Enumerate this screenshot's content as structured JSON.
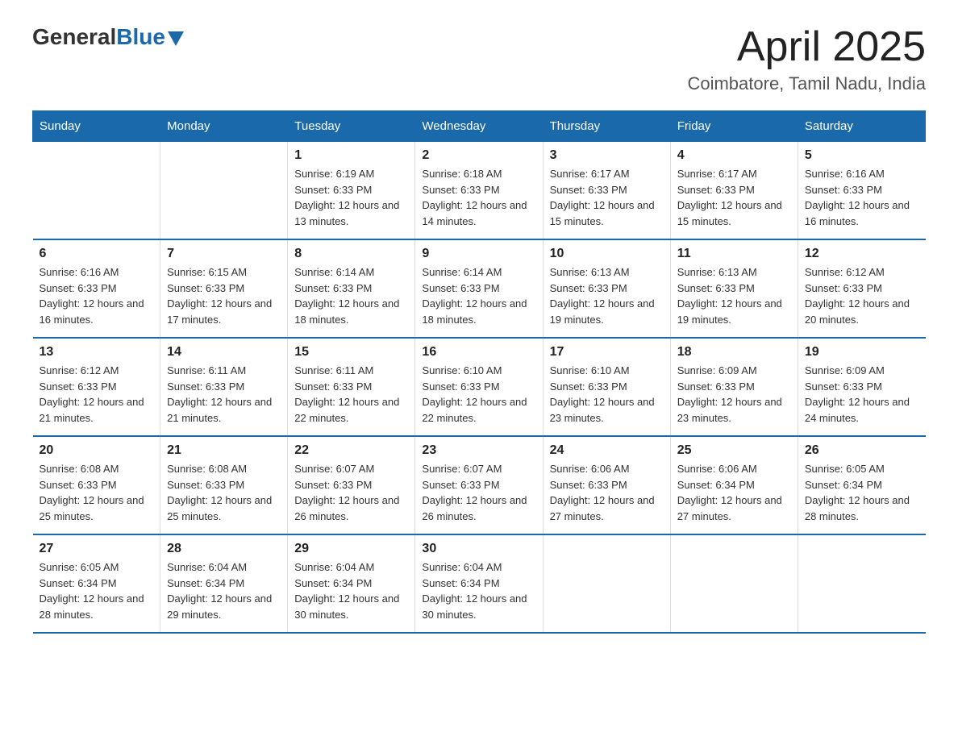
{
  "logo": {
    "general": "General",
    "blue": "Blue"
  },
  "header": {
    "title": "April 2025",
    "location": "Coimbatore, Tamil Nadu, India"
  },
  "weekdays": [
    "Sunday",
    "Monday",
    "Tuesday",
    "Wednesday",
    "Thursday",
    "Friday",
    "Saturday"
  ],
  "weeks": [
    [
      {
        "day": "",
        "sunrise": "",
        "sunset": "",
        "daylight": ""
      },
      {
        "day": "",
        "sunrise": "",
        "sunset": "",
        "daylight": ""
      },
      {
        "day": "1",
        "sunrise": "Sunrise: 6:19 AM",
        "sunset": "Sunset: 6:33 PM",
        "daylight": "Daylight: 12 hours and 13 minutes."
      },
      {
        "day": "2",
        "sunrise": "Sunrise: 6:18 AM",
        "sunset": "Sunset: 6:33 PM",
        "daylight": "Daylight: 12 hours and 14 minutes."
      },
      {
        "day": "3",
        "sunrise": "Sunrise: 6:17 AM",
        "sunset": "Sunset: 6:33 PM",
        "daylight": "Daylight: 12 hours and 15 minutes."
      },
      {
        "day": "4",
        "sunrise": "Sunrise: 6:17 AM",
        "sunset": "Sunset: 6:33 PM",
        "daylight": "Daylight: 12 hours and 15 minutes."
      },
      {
        "day": "5",
        "sunrise": "Sunrise: 6:16 AM",
        "sunset": "Sunset: 6:33 PM",
        "daylight": "Daylight: 12 hours and 16 minutes."
      }
    ],
    [
      {
        "day": "6",
        "sunrise": "Sunrise: 6:16 AM",
        "sunset": "Sunset: 6:33 PM",
        "daylight": "Daylight: 12 hours and 16 minutes."
      },
      {
        "day": "7",
        "sunrise": "Sunrise: 6:15 AM",
        "sunset": "Sunset: 6:33 PM",
        "daylight": "Daylight: 12 hours and 17 minutes."
      },
      {
        "day": "8",
        "sunrise": "Sunrise: 6:14 AM",
        "sunset": "Sunset: 6:33 PM",
        "daylight": "Daylight: 12 hours and 18 minutes."
      },
      {
        "day": "9",
        "sunrise": "Sunrise: 6:14 AM",
        "sunset": "Sunset: 6:33 PM",
        "daylight": "Daylight: 12 hours and 18 minutes."
      },
      {
        "day": "10",
        "sunrise": "Sunrise: 6:13 AM",
        "sunset": "Sunset: 6:33 PM",
        "daylight": "Daylight: 12 hours and 19 minutes."
      },
      {
        "day": "11",
        "sunrise": "Sunrise: 6:13 AM",
        "sunset": "Sunset: 6:33 PM",
        "daylight": "Daylight: 12 hours and 19 minutes."
      },
      {
        "day": "12",
        "sunrise": "Sunrise: 6:12 AM",
        "sunset": "Sunset: 6:33 PM",
        "daylight": "Daylight: 12 hours and 20 minutes."
      }
    ],
    [
      {
        "day": "13",
        "sunrise": "Sunrise: 6:12 AM",
        "sunset": "Sunset: 6:33 PM",
        "daylight": "Daylight: 12 hours and 21 minutes."
      },
      {
        "day": "14",
        "sunrise": "Sunrise: 6:11 AM",
        "sunset": "Sunset: 6:33 PM",
        "daylight": "Daylight: 12 hours and 21 minutes."
      },
      {
        "day": "15",
        "sunrise": "Sunrise: 6:11 AM",
        "sunset": "Sunset: 6:33 PM",
        "daylight": "Daylight: 12 hours and 22 minutes."
      },
      {
        "day": "16",
        "sunrise": "Sunrise: 6:10 AM",
        "sunset": "Sunset: 6:33 PM",
        "daylight": "Daylight: 12 hours and 22 minutes."
      },
      {
        "day": "17",
        "sunrise": "Sunrise: 6:10 AM",
        "sunset": "Sunset: 6:33 PM",
        "daylight": "Daylight: 12 hours and 23 minutes."
      },
      {
        "day": "18",
        "sunrise": "Sunrise: 6:09 AM",
        "sunset": "Sunset: 6:33 PM",
        "daylight": "Daylight: 12 hours and 23 minutes."
      },
      {
        "day": "19",
        "sunrise": "Sunrise: 6:09 AM",
        "sunset": "Sunset: 6:33 PM",
        "daylight": "Daylight: 12 hours and 24 minutes."
      }
    ],
    [
      {
        "day": "20",
        "sunrise": "Sunrise: 6:08 AM",
        "sunset": "Sunset: 6:33 PM",
        "daylight": "Daylight: 12 hours and 25 minutes."
      },
      {
        "day": "21",
        "sunrise": "Sunrise: 6:08 AM",
        "sunset": "Sunset: 6:33 PM",
        "daylight": "Daylight: 12 hours and 25 minutes."
      },
      {
        "day": "22",
        "sunrise": "Sunrise: 6:07 AM",
        "sunset": "Sunset: 6:33 PM",
        "daylight": "Daylight: 12 hours and 26 minutes."
      },
      {
        "day": "23",
        "sunrise": "Sunrise: 6:07 AM",
        "sunset": "Sunset: 6:33 PM",
        "daylight": "Daylight: 12 hours and 26 minutes."
      },
      {
        "day": "24",
        "sunrise": "Sunrise: 6:06 AM",
        "sunset": "Sunset: 6:33 PM",
        "daylight": "Daylight: 12 hours and 27 minutes."
      },
      {
        "day": "25",
        "sunrise": "Sunrise: 6:06 AM",
        "sunset": "Sunset: 6:34 PM",
        "daylight": "Daylight: 12 hours and 27 minutes."
      },
      {
        "day": "26",
        "sunrise": "Sunrise: 6:05 AM",
        "sunset": "Sunset: 6:34 PM",
        "daylight": "Daylight: 12 hours and 28 minutes."
      }
    ],
    [
      {
        "day": "27",
        "sunrise": "Sunrise: 6:05 AM",
        "sunset": "Sunset: 6:34 PM",
        "daylight": "Daylight: 12 hours and 28 minutes."
      },
      {
        "day": "28",
        "sunrise": "Sunrise: 6:04 AM",
        "sunset": "Sunset: 6:34 PM",
        "daylight": "Daylight: 12 hours and 29 minutes."
      },
      {
        "day": "29",
        "sunrise": "Sunrise: 6:04 AM",
        "sunset": "Sunset: 6:34 PM",
        "daylight": "Daylight: 12 hours and 30 minutes."
      },
      {
        "day": "30",
        "sunrise": "Sunrise: 6:04 AM",
        "sunset": "Sunset: 6:34 PM",
        "daylight": "Daylight: 12 hours and 30 minutes."
      },
      {
        "day": "",
        "sunrise": "",
        "sunset": "",
        "daylight": ""
      },
      {
        "day": "",
        "sunrise": "",
        "sunset": "",
        "daylight": ""
      },
      {
        "day": "",
        "sunrise": "",
        "sunset": "",
        "daylight": ""
      }
    ]
  ]
}
